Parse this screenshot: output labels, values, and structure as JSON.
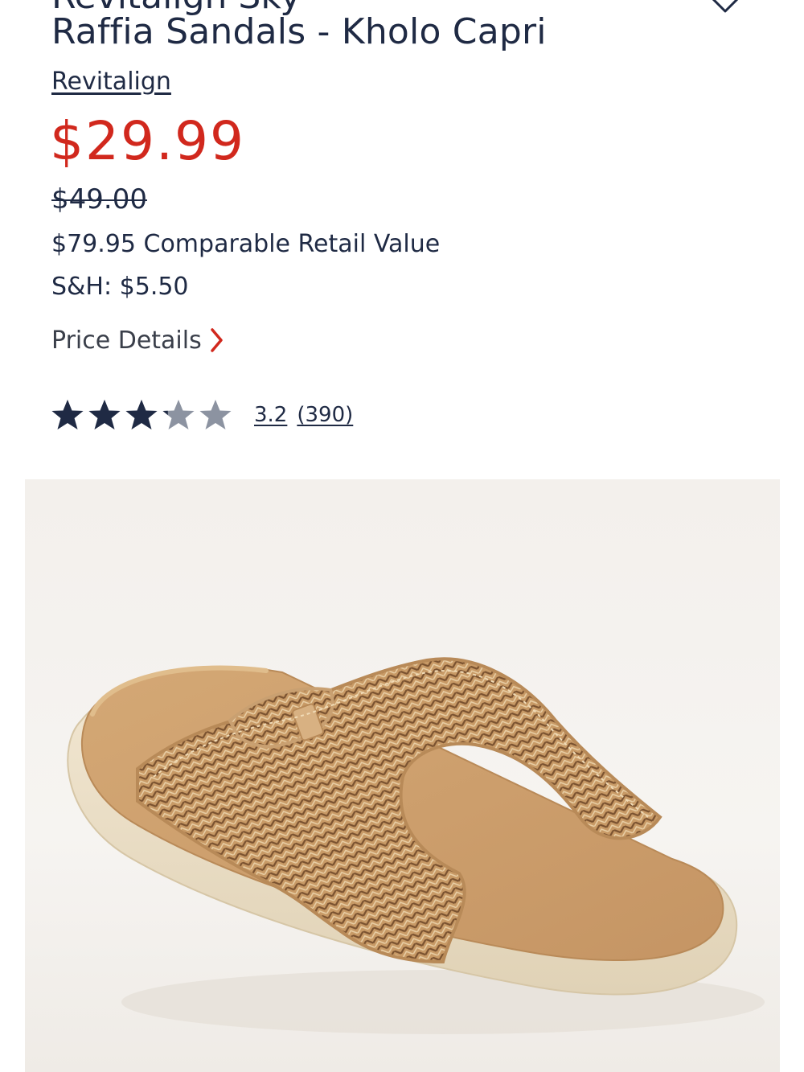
{
  "product": {
    "title_clipped": "Revitalign Sky",
    "title": "Raffia Sandals - Kholo Capri",
    "brand": "Revitalign",
    "sale_price": "$29.99",
    "original_price": "$49.00",
    "comparable_value": "$79.95 Comparable Retail Value",
    "shipping": "S&H: $5.50",
    "price_details_label": "Price Details",
    "rating": {
      "value": 3.2,
      "value_label": "3.2",
      "count_label": "(390)",
      "max_stars": 5
    }
  },
  "colors": {
    "sale_price": "#d1281d",
    "text": "#1f2a44",
    "chevron": "#d1281d",
    "star_filled": "#1f2a44",
    "star_empty": "#8c93a1"
  },
  "icons": {
    "favorite": "heart-icon",
    "price_details": "chevron-right-icon",
    "star": "star-icon"
  },
  "image": {
    "alt": "Raffia Sandals - Kholo Capri"
  }
}
